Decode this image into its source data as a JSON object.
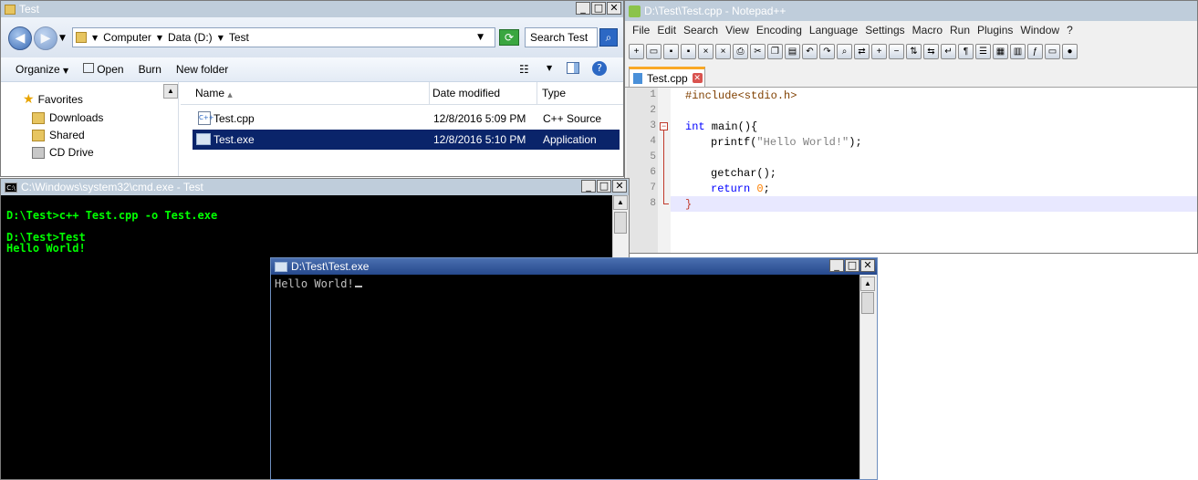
{
  "explorer": {
    "title": "Test",
    "breadcrumb": [
      "Computer",
      "Data (D:)",
      "Test"
    ],
    "search_placeholder": "Search Test",
    "commands": [
      "Organize",
      "Open",
      "Burn",
      "New folder"
    ],
    "nav": {
      "favorites": "Favorites",
      "items": [
        "Downloads",
        "Shared",
        "CD Drive"
      ]
    },
    "columns": {
      "name": "Name",
      "date": "Date modified",
      "type": "Type"
    },
    "files": [
      {
        "name": "Test.cpp",
        "date": "12/8/2016 5:09 PM",
        "type": "C++ Source"
      },
      {
        "name": "Test.exe",
        "date": "12/8/2016 5:10 PM",
        "type": "Application"
      }
    ]
  },
  "notepad": {
    "title": "D:\\Test\\Test.cpp - Notepad++",
    "menu": [
      "File",
      "Edit",
      "Search",
      "View",
      "Encoding",
      "Language",
      "Settings",
      "Macro",
      "Run",
      "Plugins",
      "Window",
      "?"
    ],
    "tab": "Test.cpp",
    "line_numbers": [
      "1",
      "2",
      "3",
      "4",
      "5",
      "6",
      "7",
      "8"
    ],
    "code": {
      "l1": "#include<stdio.h>",
      "l3_kw": "int",
      "l3_rest": " main(){",
      "l4_fn": "printf(",
      "l4_str": "\"Hello World!\"",
      "l4_end": ");",
      "l6": "getchar();",
      "l7_kw": "return",
      "l7_num": "0",
      "l7_end": ";",
      "l8": "}"
    }
  },
  "cmd": {
    "title": "C:\\Windows\\system32\\cmd.exe - Test",
    "lines": [
      "D:\\Test>c++ Test.cpp -o Test.exe",
      "",
      "D:\\Test>Test",
      "Hello World!"
    ]
  },
  "exe": {
    "title": "D:\\Test\\Test.exe",
    "output": "Hello World!"
  },
  "colors": {
    "selection": "#0a246a",
    "terminal_green": "#00ff00",
    "keyword_blue": "#0000ff"
  }
}
